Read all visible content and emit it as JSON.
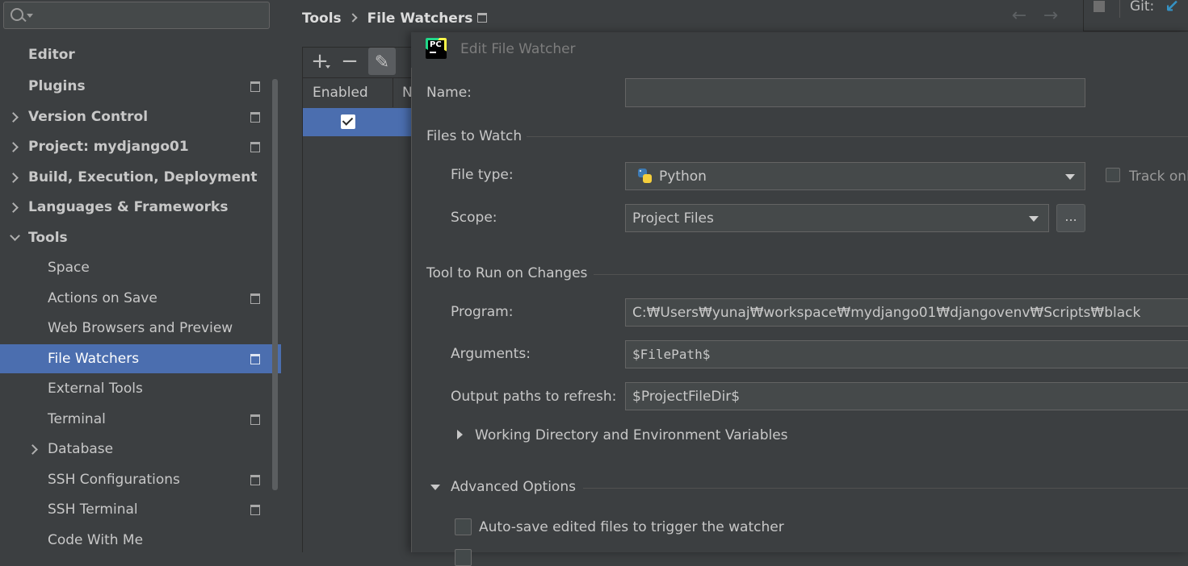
{
  "sidebar": {
    "search_placeholder": "",
    "items": [
      {
        "label": "Editor"
      },
      {
        "label": "Plugins"
      },
      {
        "label": "Version Control"
      },
      {
        "label": "Project: mydjango01"
      },
      {
        "label": "Build, Execution, Deployment"
      },
      {
        "label": "Languages & Frameworks"
      },
      {
        "label": "Tools"
      },
      {
        "label": "Space"
      },
      {
        "label": "Actions on Save"
      },
      {
        "label": "Web Browsers and Preview"
      },
      {
        "label": "File Watchers"
      },
      {
        "label": "External Tools"
      },
      {
        "label": "Terminal"
      },
      {
        "label": "Database"
      },
      {
        "label": "SSH Configurations"
      },
      {
        "label": "SSH Terminal"
      },
      {
        "label": "Code With Me"
      }
    ]
  },
  "header": {
    "breadcrumb": [
      "Tools",
      "File Watchers"
    ],
    "back_arrow": "←",
    "forward_arrow": "→",
    "git_label": "Git:"
  },
  "watchers": {
    "toolbar": {
      "add": "+",
      "remove": "−",
      "edit": "✎"
    },
    "columns": [
      "Enabled",
      "N"
    ],
    "rows": [
      {
        "enabled": true
      }
    ]
  },
  "dialog": {
    "title": "Edit File Watcher",
    "logo_text": "PC",
    "name_label": "Name:",
    "name_value": "",
    "files_section": "Files to Watch",
    "file_type_label": "File type:",
    "file_type_value": "Python",
    "track_label": "Track onl",
    "scope_label": "Scope:",
    "scope_value": "Project Files",
    "scope_more": "...",
    "tool_section": "Tool to Run on Changes",
    "program_label": "Program:",
    "program_value": "C:₩Users₩yunaj₩workspace₩mydjango01₩djangovenv₩Scripts₩black",
    "arguments_label": "Arguments:",
    "arguments_value": "$FilePath$",
    "output_label": "Output paths to refresh:",
    "output_value": "$ProjectFileDir$",
    "working_dir_label": "Working Directory and Environment Variables",
    "advanced_label": "Advanced Options",
    "autosave_label": "Auto-save edited files to trigger the watcher"
  },
  "colors": {
    "background": "#3c3f41",
    "selection": "#4b6eaf",
    "field": "#45494a",
    "accent_git": "#3592c4"
  }
}
